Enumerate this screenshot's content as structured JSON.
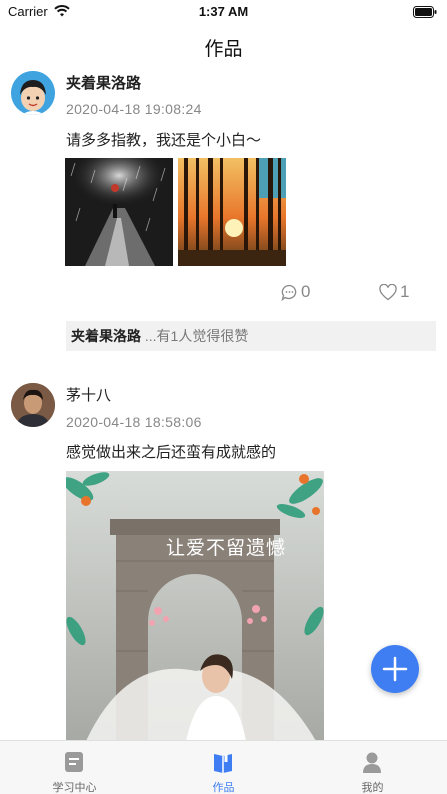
{
  "status_bar": {
    "carrier": "Carrier",
    "time": "1:37 AM"
  },
  "nav": {
    "title": "作品"
  },
  "posts": [
    {
      "author": "夹着果洛路",
      "time": "2020-04-18 19:08:24",
      "content": "请多多指教，我还是个小白～",
      "comments": "0",
      "likes": "1",
      "likes_bar": {
        "liker": "夹着果洛路",
        "text": " ...有1人觉得很赞"
      }
    },
    {
      "author": "茅十八",
      "time": "2020-04-18 18:58:06",
      "content": "感觉做出来之后还蛮有成就感的",
      "image_caption": "让爱不留遗憾"
    }
  ],
  "tabs": [
    {
      "label": "学习中心",
      "icon": "study-center-icon"
    },
    {
      "label": "作品",
      "icon": "works-icon",
      "active": true
    },
    {
      "label": "我的",
      "icon": "profile-icon"
    }
  ],
  "colors": {
    "accent": "#3e7ef2",
    "muted": "#888888",
    "likes_bar_bg": "#f1f1f1"
  }
}
